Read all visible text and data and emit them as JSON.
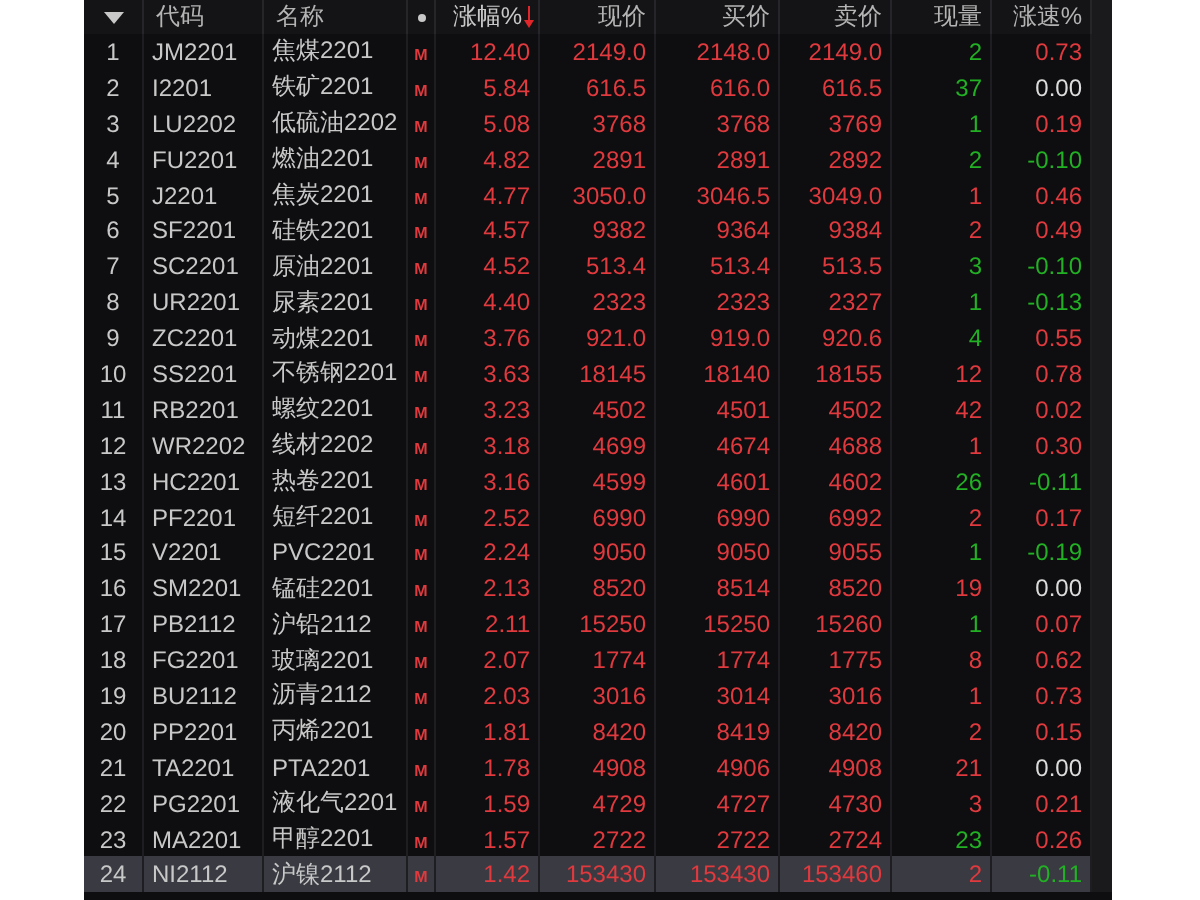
{
  "header": {
    "columns": [
      {
        "label": "代码",
        "sorted": false
      },
      {
        "label": "名称",
        "sorted": false
      },
      {
        "label": "涨幅%",
        "sorted": true
      },
      {
        "label": "现价",
        "sorted": false
      },
      {
        "label": "买价",
        "sorted": false
      },
      {
        "label": "卖价",
        "sorted": false
      },
      {
        "label": "现量",
        "sorted": false
      },
      {
        "label": "涨速%",
        "sorted": false
      }
    ]
  },
  "rows": [
    {
      "index": "1",
      "code": "JM2201",
      "name": "焦煤2201",
      "flag": "M",
      "change": "12.40",
      "price": "2149.0",
      "bid": "2148.0",
      "ask": "2149.0",
      "color": "#e0393e",
      "volume": {
        "text": "2",
        "color": "#22b024"
      },
      "speed": {
        "text": "0.73",
        "color": "#e0393e"
      },
      "selected": false
    },
    {
      "index": "2",
      "code": "I2201",
      "name": "铁矿2201",
      "flag": "M",
      "change": "5.84",
      "price": "616.5",
      "bid": "616.0",
      "ask": "616.5",
      "color": "#e0393e",
      "volume": {
        "text": "37",
        "color": "#22b024"
      },
      "speed": {
        "text": "0.00",
        "color": "#dcdcdc"
      },
      "selected": false
    },
    {
      "index": "3",
      "code": "LU2202",
      "name": "低硫油2202",
      "flag": "M",
      "change": "5.08",
      "price": "3768",
      "bid": "3768",
      "ask": "3769",
      "color": "#e0393e",
      "volume": {
        "text": "1",
        "color": "#22b024"
      },
      "speed": {
        "text": "0.19",
        "color": "#e0393e"
      },
      "selected": false
    },
    {
      "index": "4",
      "code": "FU2201",
      "name": "燃油2201",
      "flag": "M",
      "change": "4.82",
      "price": "2891",
      "bid": "2891",
      "ask": "2892",
      "color": "#e0393e",
      "volume": {
        "text": "2",
        "color": "#22b024"
      },
      "speed": {
        "text": "-0.10",
        "color": "#22b024"
      },
      "selected": false
    },
    {
      "index": "5",
      "code": "J2201",
      "name": "焦炭2201",
      "flag": "M",
      "change": "4.77",
      "price": "3050.0",
      "bid": "3046.5",
      "ask": "3049.0",
      "color": "#e0393e",
      "volume": {
        "text": "1",
        "color": "#e0393e"
      },
      "speed": {
        "text": "0.46",
        "color": "#e0393e"
      },
      "selected": false
    },
    {
      "index": "6",
      "code": "SF2201",
      "name": "硅铁2201",
      "flag": "M",
      "change": "4.57",
      "price": "9382",
      "bid": "9364",
      "ask": "9384",
      "color": "#e0393e",
      "volume": {
        "text": "2",
        "color": "#e0393e"
      },
      "speed": {
        "text": "0.49",
        "color": "#e0393e"
      },
      "selected": false
    },
    {
      "index": "7",
      "code": "SC2201",
      "name": "原油2201",
      "flag": "M",
      "change": "4.52",
      "price": "513.4",
      "bid": "513.4",
      "ask": "513.5",
      "color": "#e0393e",
      "volume": {
        "text": "3",
        "color": "#22b024"
      },
      "speed": {
        "text": "-0.10",
        "color": "#22b024"
      },
      "selected": false
    },
    {
      "index": "8",
      "code": "UR2201",
      "name": "尿素2201",
      "flag": "M",
      "change": "4.40",
      "price": "2323",
      "bid": "2323",
      "ask": "2327",
      "color": "#e0393e",
      "volume": {
        "text": "1",
        "color": "#22b024"
      },
      "speed": {
        "text": "-0.13",
        "color": "#22b024"
      },
      "selected": false
    },
    {
      "index": "9",
      "code": "ZC2201",
      "name": "动煤2201",
      "flag": "M",
      "change": "3.76",
      "price": "921.0",
      "bid": "919.0",
      "ask": "920.6",
      "color": "#e0393e",
      "volume": {
        "text": "4",
        "color": "#22b024"
      },
      "speed": {
        "text": "0.55",
        "color": "#e0393e"
      },
      "selected": false
    },
    {
      "index": "10",
      "code": "SS2201",
      "name": "不锈钢2201",
      "flag": "M",
      "change": "3.63",
      "price": "18145",
      "bid": "18140",
      "ask": "18155",
      "color": "#e0393e",
      "volume": {
        "text": "12",
        "color": "#e0393e"
      },
      "speed": {
        "text": "0.78",
        "color": "#e0393e"
      },
      "selected": false
    },
    {
      "index": "11",
      "code": "RB2201",
      "name": "螺纹2201",
      "flag": "M",
      "change": "3.23",
      "price": "4502",
      "bid": "4501",
      "ask": "4502",
      "color": "#e0393e",
      "volume": {
        "text": "42",
        "color": "#e0393e"
      },
      "speed": {
        "text": "0.02",
        "color": "#e0393e"
      },
      "selected": false
    },
    {
      "index": "12",
      "code": "WR2202",
      "name": "线材2202",
      "flag": "M",
      "change": "3.18",
      "price": "4699",
      "bid": "4674",
      "ask": "4688",
      "color": "#e0393e",
      "volume": {
        "text": "1",
        "color": "#e0393e"
      },
      "speed": {
        "text": "0.30",
        "color": "#e0393e"
      },
      "selected": false
    },
    {
      "index": "13",
      "code": "HC2201",
      "name": "热卷2201",
      "flag": "M",
      "change": "3.16",
      "price": "4599",
      "bid": "4601",
      "ask": "4602",
      "color": "#e0393e",
      "volume": {
        "text": "26",
        "color": "#22b024"
      },
      "speed": {
        "text": "-0.11",
        "color": "#22b024"
      },
      "selected": false
    },
    {
      "index": "14",
      "code": "PF2201",
      "name": "短纤2201",
      "flag": "M",
      "change": "2.52",
      "price": "6990",
      "bid": "6990",
      "ask": "6992",
      "color": "#e0393e",
      "volume": {
        "text": "2",
        "color": "#e0393e"
      },
      "speed": {
        "text": "0.17",
        "color": "#e0393e"
      },
      "selected": false
    },
    {
      "index": "15",
      "code": "V2201",
      "name": "PVC2201",
      "flag": "M",
      "change": "2.24",
      "price": "9050",
      "bid": "9050",
      "ask": "9055",
      "color": "#e0393e",
      "volume": {
        "text": "1",
        "color": "#22b024"
      },
      "speed": {
        "text": "-0.19",
        "color": "#22b024"
      },
      "selected": false
    },
    {
      "index": "16",
      "code": "SM2201",
      "name": "锰硅2201",
      "flag": "M",
      "change": "2.13",
      "price": "8520",
      "bid": "8514",
      "ask": "8520",
      "color": "#e0393e",
      "volume": {
        "text": "19",
        "color": "#e0393e"
      },
      "speed": {
        "text": "0.00",
        "color": "#dcdcdc"
      },
      "selected": false
    },
    {
      "index": "17",
      "code": "PB2112",
      "name": "沪铅2112",
      "flag": "M",
      "change": "2.11",
      "price": "15250",
      "bid": "15250",
      "ask": "15260",
      "color": "#e0393e",
      "volume": {
        "text": "1",
        "color": "#22b024"
      },
      "speed": {
        "text": "0.07",
        "color": "#e0393e"
      },
      "selected": false
    },
    {
      "index": "18",
      "code": "FG2201",
      "name": "玻璃2201",
      "flag": "M",
      "change": "2.07",
      "price": "1774",
      "bid": "1774",
      "ask": "1775",
      "color": "#e0393e",
      "volume": {
        "text": "8",
        "color": "#e0393e"
      },
      "speed": {
        "text": "0.62",
        "color": "#e0393e"
      },
      "selected": false
    },
    {
      "index": "19",
      "code": "BU2112",
      "name": "沥青2112",
      "flag": "M",
      "change": "2.03",
      "price": "3016",
      "bid": "3014",
      "ask": "3016",
      "color": "#e0393e",
      "volume": {
        "text": "1",
        "color": "#e0393e"
      },
      "speed": {
        "text": "0.73",
        "color": "#e0393e"
      },
      "selected": false
    },
    {
      "index": "20",
      "code": "PP2201",
      "name": "丙烯2201",
      "flag": "M",
      "change": "1.81",
      "price": "8420",
      "bid": "8419",
      "ask": "8420",
      "color": "#e0393e",
      "volume": {
        "text": "2",
        "color": "#e0393e"
      },
      "speed": {
        "text": "0.15",
        "color": "#e0393e"
      },
      "selected": false
    },
    {
      "index": "21",
      "code": "TA2201",
      "name": "PTA2201",
      "flag": "M",
      "change": "1.78",
      "price": "4908",
      "bid": "4906",
      "ask": "4908",
      "color": "#e0393e",
      "volume": {
        "text": "21",
        "color": "#e0393e"
      },
      "speed": {
        "text": "0.00",
        "color": "#dcdcdc"
      },
      "selected": false
    },
    {
      "index": "22",
      "code": "PG2201",
      "name": "液化气2201",
      "flag": "M",
      "change": "1.59",
      "price": "4729",
      "bid": "4727",
      "ask": "4730",
      "color": "#e0393e",
      "volume": {
        "text": "3",
        "color": "#e0393e"
      },
      "speed": {
        "text": "0.21",
        "color": "#e0393e"
      },
      "selected": false
    },
    {
      "index": "23",
      "code": "MA2201",
      "name": "甲醇2201",
      "flag": "M",
      "change": "1.57",
      "price": "2722",
      "bid": "2722",
      "ask": "2724",
      "color": "#e0393e",
      "volume": {
        "text": "23",
        "color": "#22b024"
      },
      "speed": {
        "text": "0.26",
        "color": "#e0393e"
      },
      "selected": false
    },
    {
      "index": "24",
      "code": "NI2112",
      "name": "沪镍2112",
      "flag": "M",
      "change": "1.42",
      "price": "153430",
      "bid": "153430",
      "ask": "153460",
      "color": "#e0393e",
      "volume": {
        "text": "2",
        "color": "#e0393e"
      },
      "speed": {
        "text": "-0.11",
        "color": "#22b024"
      },
      "selected": true
    }
  ]
}
